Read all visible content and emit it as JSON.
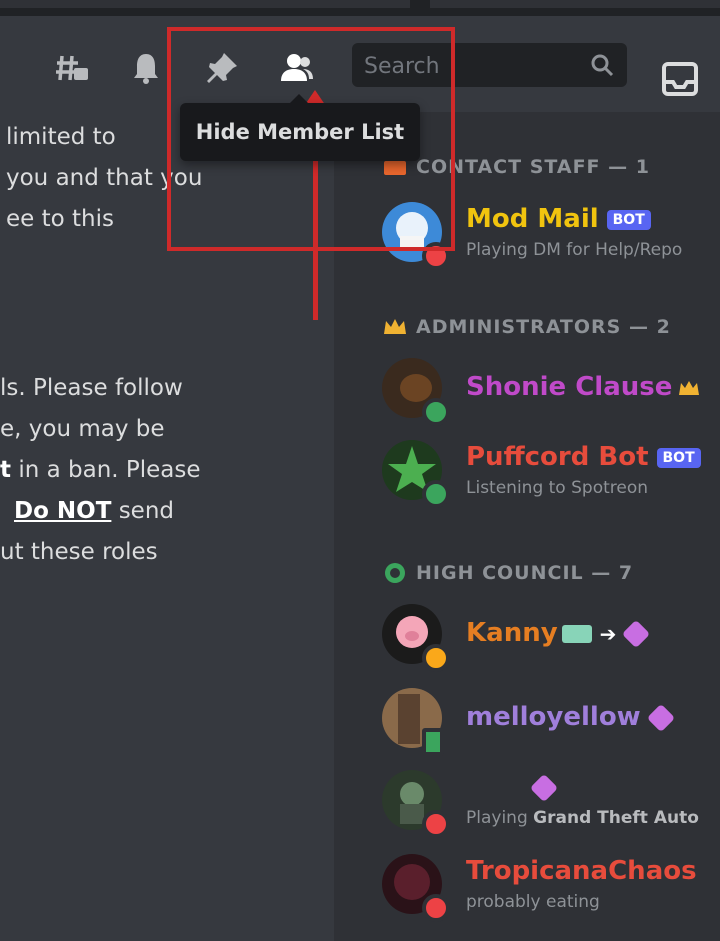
{
  "header": {
    "icons": [
      "threads-icon",
      "bell-icon",
      "pin-icon",
      "member-list-icon"
    ],
    "search_placeholder": "Search",
    "tooltip": "Hide Member List"
  },
  "chat": {
    "lines1": [
      "limited to",
      "you and that you",
      "ee to this"
    ],
    "lines2": [
      "ls. Please follow",
      "e, you may be",
      "in a ban. Please",
      "Do NOT",
      "send",
      "ut these roles"
    ],
    "highlight_t": "t"
  },
  "members": {
    "categories": {
      "contact_staff": "CONTACT STAFF — 1",
      "administrators": "ADMINISTRATORS — 2",
      "high_council": "HIGH COUNCIL — 7"
    },
    "list": [
      {
        "name": "Mod Mail",
        "activity": "Playing DM for Help/Repo",
        "color": "#f1c40f",
        "bot": "BOT",
        "status": "dnd"
      },
      {
        "name": "Shonie Clause",
        "activity": "",
        "color": "#c04ac9",
        "status": "online"
      },
      {
        "name": "Puffcord Bot",
        "activity": "Listening to Spotreon",
        "color": "#e74c3c",
        "bot": "BOT",
        "status": "online"
      },
      {
        "name": "Kanny",
        "activity": "",
        "color": "#e67e22",
        "status": "idle"
      },
      {
        "name": "melloyellow",
        "activity": "",
        "color": "#a07fdb",
        "status": "mobile"
      },
      {
        "name": "",
        "activity_prefix": "Playing",
        "activity_bold": "Grand Theft Auto",
        "color": "#dcddde",
        "status": "dnd"
      },
      {
        "name": "TropicanaChaos",
        "activity": "probably eating",
        "color": "#e74c3c",
        "status": "dnd"
      }
    ]
  },
  "colors": {
    "online": "#3ba55d",
    "idle": "#faa81a",
    "dnd": "#ed4245",
    "annotation": "#cf2a2a"
  }
}
